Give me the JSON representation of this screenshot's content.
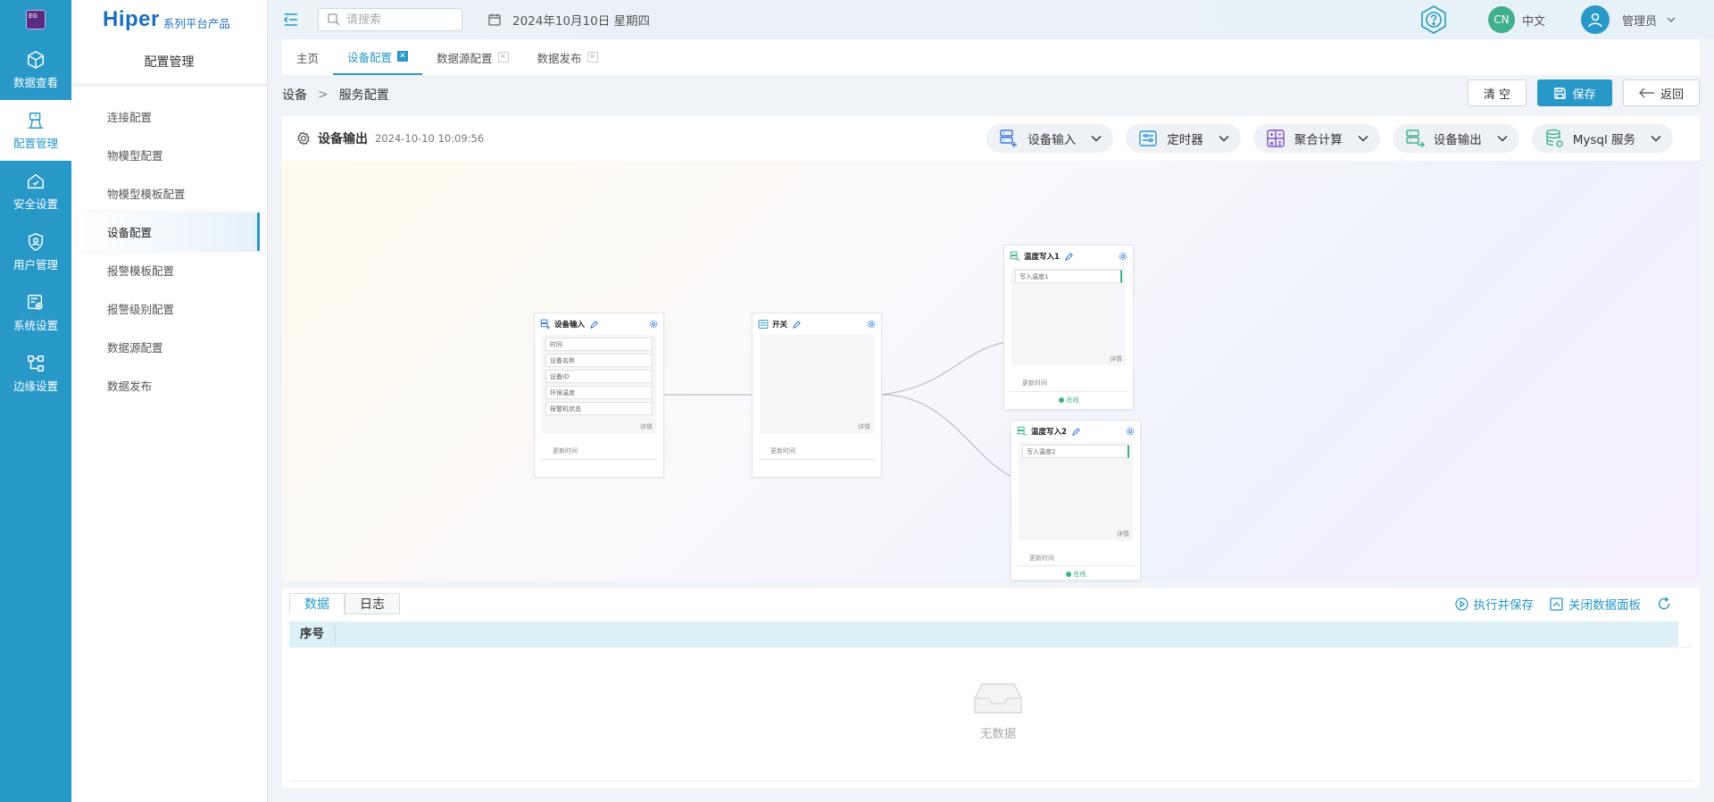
{
  "app": {
    "logo_text": "EG",
    "brand_main": "Hiper",
    "brand_sub": "系列平台产品"
  },
  "rail": [
    {
      "label": "数据查看",
      "icon": "cube-icon"
    },
    {
      "label": "配置管理",
      "icon": "config-icon",
      "active": true
    },
    {
      "label": "安全设置",
      "icon": "home-shield-icon"
    },
    {
      "label": "用户管理",
      "icon": "user-shield-icon"
    },
    {
      "label": "系统设置",
      "icon": "system-gear-icon"
    },
    {
      "label": "边缘设置",
      "icon": "edge-network-icon"
    }
  ],
  "sidebar": {
    "title": "配置管理",
    "items": [
      {
        "label": "连接配置"
      },
      {
        "label": "物模型配置"
      },
      {
        "label": "物模型模板配置"
      },
      {
        "label": "设备配置",
        "active": true
      },
      {
        "label": "报警模板配置"
      },
      {
        "label": "报警级别配置"
      },
      {
        "label": "数据源配置"
      },
      {
        "label": "数据发布"
      }
    ]
  },
  "topbar": {
    "search_placeholder": "请搜索",
    "date": "2024年10月10日 星期四",
    "lang_badge": "CN",
    "lang_text": "中文",
    "user": "管理员"
  },
  "tabs": [
    {
      "label": "主页",
      "closable": false
    },
    {
      "label": "设备配置",
      "closable": true,
      "active": true
    },
    {
      "label": "数据源配置",
      "closable": true
    },
    {
      "label": "数据发布",
      "closable": true
    }
  ],
  "breadcrumb": {
    "root": "设备",
    "sep": ">",
    "current": "服务配置"
  },
  "actions": {
    "clear": "清 空",
    "save": "保存",
    "back": "返回"
  },
  "flow": {
    "title": "设备输出",
    "timestamp": "2024-10-10 10:09:56",
    "tools": [
      {
        "label": "设备输入",
        "icon": "device-input-icon",
        "color": "#3a7bd5"
      },
      {
        "label": "定时器",
        "icon": "timer-icon",
        "color": "#2898c9"
      },
      {
        "label": "聚合计算",
        "icon": "calculator-icon",
        "color": "#7b4fc9"
      },
      {
        "label": "设备输出",
        "icon": "device-output-icon",
        "color": "#3fb08b"
      },
      {
        "label": "Mysql 服务",
        "icon": "database-icon",
        "color": "#3fb08b"
      }
    ],
    "nodes": {
      "input": {
        "title": "设备输入",
        "fields": [
          "时间",
          "设备名称",
          "设备ID",
          "环境温度",
          "报警机状态"
        ],
        "detail": "详情",
        "update": "更新时间"
      },
      "switch": {
        "title": "开关",
        "detail": "详情",
        "update": "更新时间"
      },
      "write1": {
        "title": "温度写入1",
        "field": "写入温度1",
        "detail": "详情",
        "update": "更新时间",
        "status": "在线"
      },
      "write2": {
        "title": "温度写入2",
        "field": "写入温度2",
        "detail": "详情",
        "update": "更新时间",
        "status": "在线"
      }
    }
  },
  "data_panel": {
    "tabs": [
      {
        "label": "数据",
        "active": true
      },
      {
        "label": "日志"
      }
    ],
    "execute": "执行并保存",
    "close_panel": "关闭数据面板",
    "columns": [
      "序号"
    ],
    "empty": "无数据"
  },
  "colors": {
    "primary": "#2898c9",
    "online": "#3fb08b"
  }
}
